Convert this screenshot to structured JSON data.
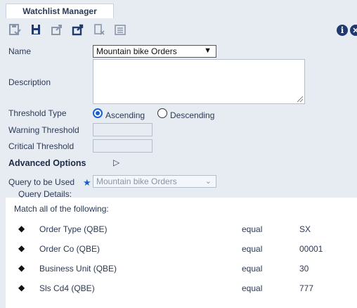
{
  "tab": {
    "label": "Watchlist Manager"
  },
  "toolbar": {
    "icons": [
      "save-check-icon",
      "save-icon",
      "export-icon",
      "publish-icon",
      "delete-icon",
      "list-icon"
    ]
  },
  "form": {
    "name_label": "Name",
    "name_value": "Mountain bike Orders",
    "description_label": "Description",
    "description_value": "",
    "threshold_type_label": "Threshold Type",
    "ascending_label": "Ascending",
    "descending_label": "Descending",
    "threshold_type_selected": "Ascending",
    "warning_label": "Warning Threshold",
    "warning_value": "",
    "critical_label": "Critical Threshold",
    "critical_value": "",
    "advanced_label": "Advanced Options",
    "query_label": "Query to be Used",
    "query_value": "Mountain bike Orders"
  },
  "query_details": {
    "legend": "Query Details:",
    "match_text": "Match all of the following:",
    "rows": [
      {
        "field": "Order Type (QBE)",
        "operator": "equal",
        "value": "SX"
      },
      {
        "field": "Order Co (QBE)",
        "operator": "equal",
        "value": "00001"
      },
      {
        "field": "Business Unit (QBE)",
        "operator": "equal",
        "value": "30"
      },
      {
        "field": "Sls Cd4 (QBE)",
        "operator": "equal",
        "value": "777"
      }
    ]
  },
  "colors": {
    "background": "#1c2230",
    "panel": "#e7ecf3",
    "accent": "#1a5fd0",
    "icon_dark": "#1f3a6e",
    "icon_muted": "#8a96aa"
  }
}
